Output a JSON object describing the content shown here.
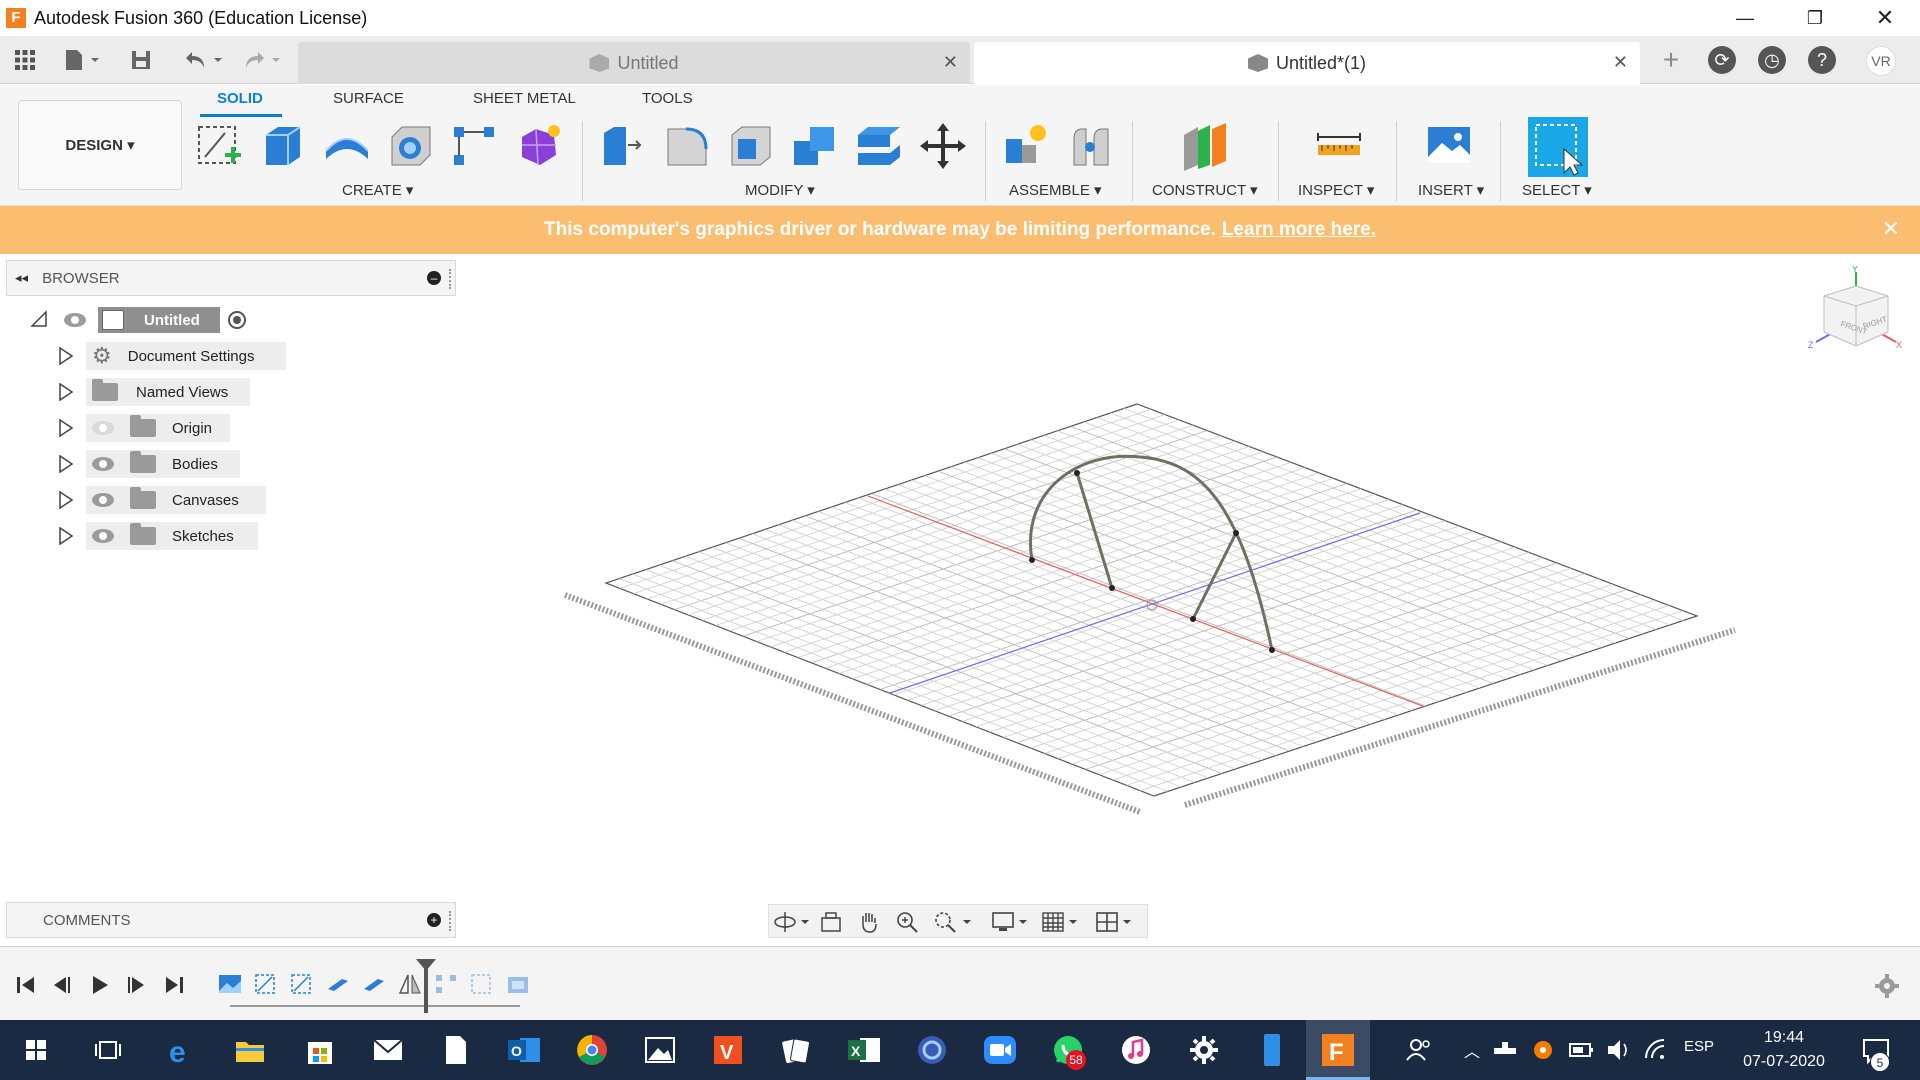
{
  "window": {
    "title": "Autodesk Fusion 360 (Education License)",
    "logo_letter": "F",
    "controls": [
      "minimize",
      "restore",
      "close"
    ]
  },
  "tabs": {
    "inactive_label": "Untitled",
    "active_label": "Untitled*(1)",
    "user_initials": "VR"
  },
  "ribbon": {
    "workspace": "DESIGN ▾",
    "tabs": [
      "SOLID",
      "SURFACE",
      "SHEET METAL",
      "TOOLS"
    ],
    "groups": [
      "CREATE ▾",
      "MODIFY ▾",
      "ASSEMBLE ▾",
      "CONSTRUCT ▾",
      "INSPECT ▾",
      "INSERT ▾",
      "SELECT ▾"
    ]
  },
  "banner": {
    "message": "This computer's graphics driver or hardware may be limiting performance.",
    "link": "Learn more here."
  },
  "browser": {
    "title": "BROWSER",
    "root": "Untitled",
    "items": [
      "Document Settings",
      "Named Views",
      "Origin",
      "Bodies",
      "Canvases",
      "Sketches"
    ]
  },
  "comments": {
    "title": "COMMENTS"
  },
  "viewcube": {
    "front": "FRONT",
    "right": "RIGHT",
    "axes": [
      "Y",
      "Z",
      "X"
    ]
  },
  "taskbar": {
    "whatsapp_badge": "58",
    "language": "ESP",
    "time": "19:44",
    "date": "07-07-2020",
    "notifications": "5"
  },
  "colors": {
    "accent": "#0a7fd8",
    "banner": "#fbbd6f",
    "taskbar": "#1a2a42",
    "x_axis": "#e06060",
    "z_axis": "#6b6bf0"
  }
}
